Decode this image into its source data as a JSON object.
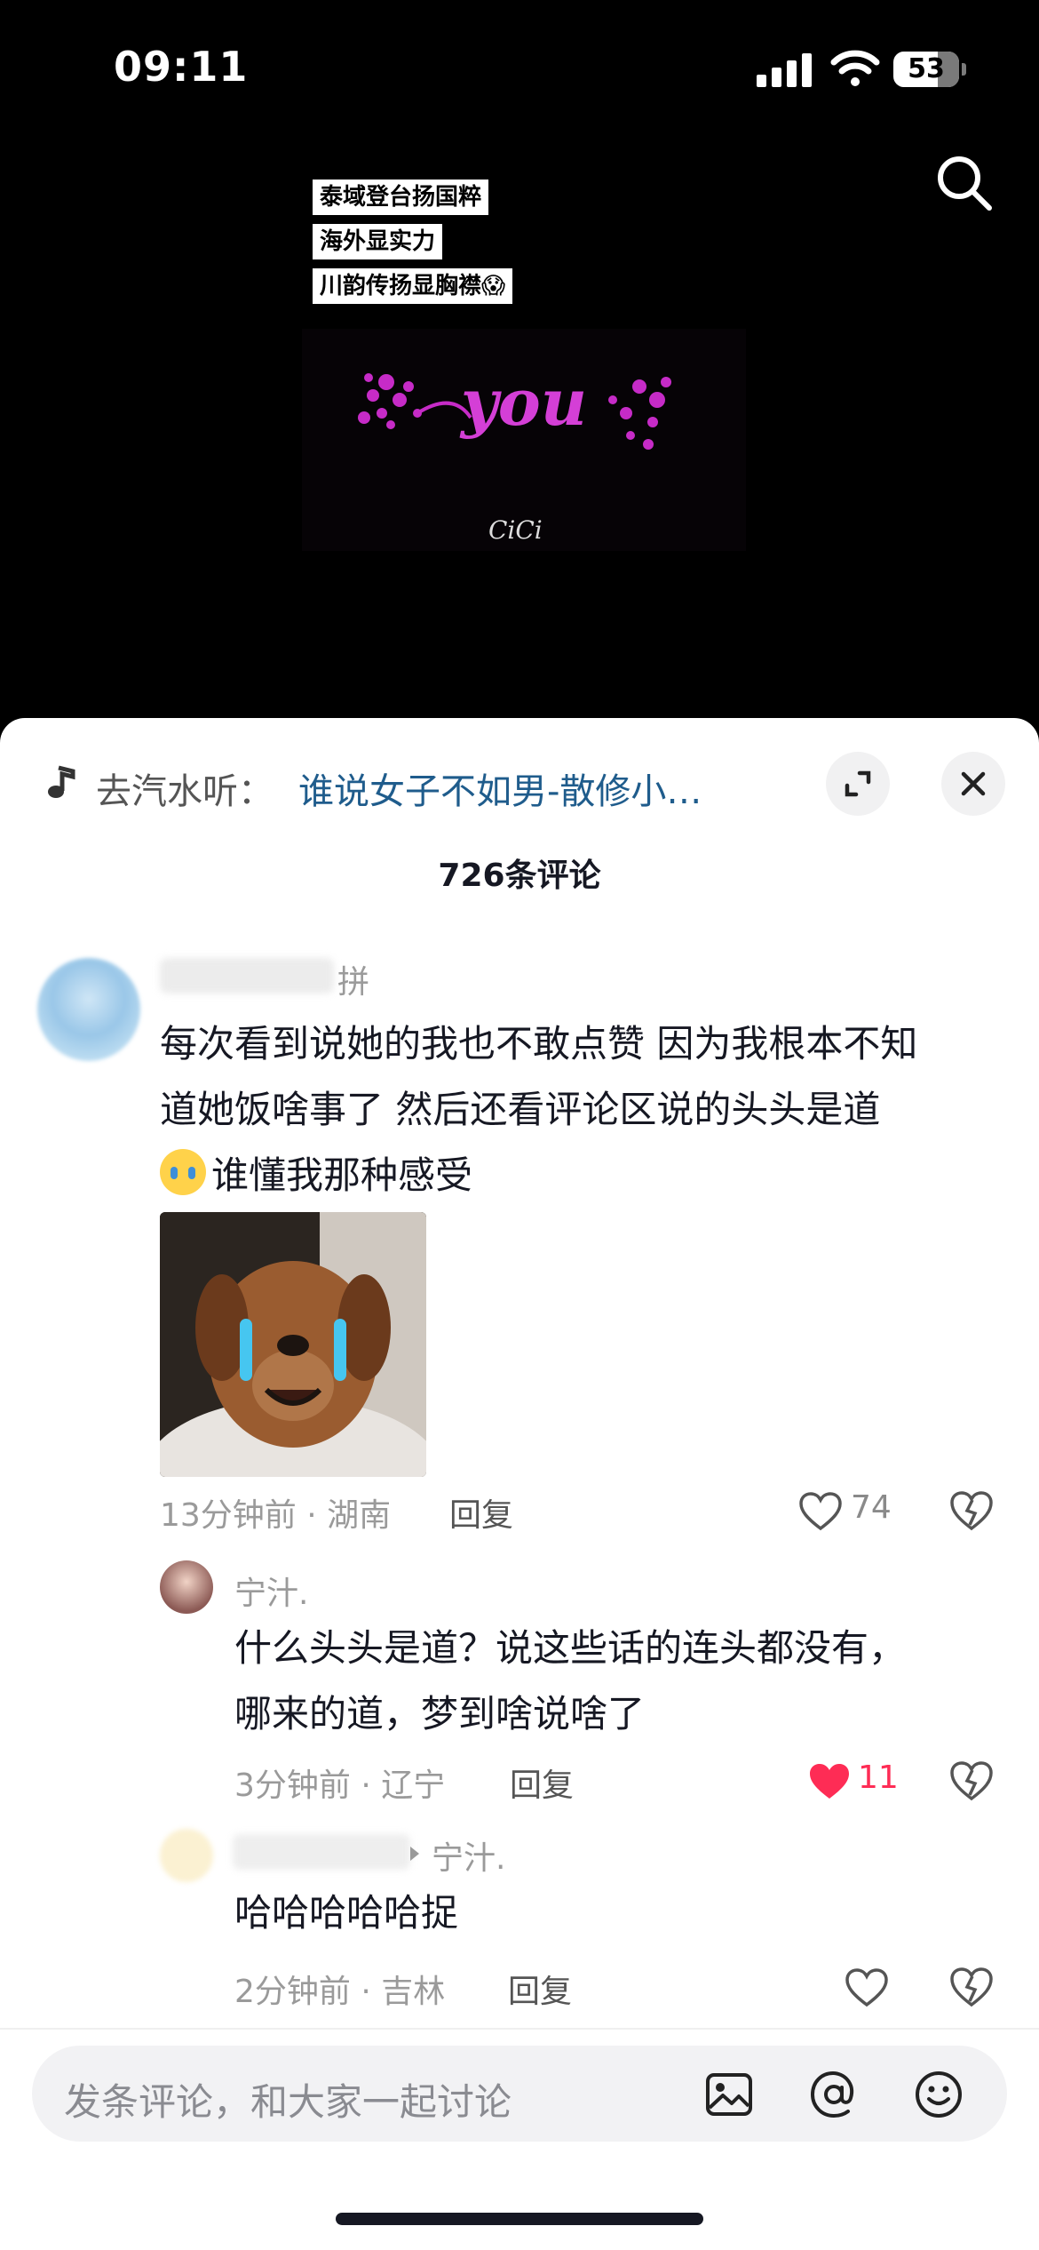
{
  "status_bar": {
    "time": "09:11",
    "battery": "53"
  },
  "video": {
    "captions": [
      "泰域登台扬国粹",
      "海外显实力",
      "川韵传扬显胸襟😱"
    ],
    "watermark": "CiCi",
    "art_word": "you"
  },
  "sheet": {
    "music_prefix": "去汽水听：",
    "music_title": "谁说女子不如男-散修小…",
    "comment_count": "726条评论"
  },
  "comments": [
    {
      "user_suffix": "拼",
      "text_line1": "每次看到说她的我也不敢点赞 因为我根本不知",
      "text_line2": "道她饭啥事了  然后还看评论区说的头头是道",
      "text_line3": "谁懂我那种感受",
      "meta": "13分钟前 · 湖南",
      "reply": "回复",
      "likes": "74"
    }
  ],
  "replies": [
    {
      "user": "宁汁.",
      "text_line1": "什么头头是道？说这些话的连头都没有，",
      "text_line2": "哪来的道，梦到啥说啥了",
      "meta": "3分钟前 · 辽宁",
      "reply": "回复",
      "likes": "11",
      "liked": true
    },
    {
      "reply_to": "宁汁.",
      "text": "哈哈哈哈哈捉",
      "meta": "2分钟前 · 吉林",
      "reply": "回复"
    }
  ],
  "input": {
    "placeholder": "发条评论，和大家一起讨论"
  },
  "colors": {
    "accent_like": "#fe2c55",
    "link": "#1f5c8c"
  }
}
